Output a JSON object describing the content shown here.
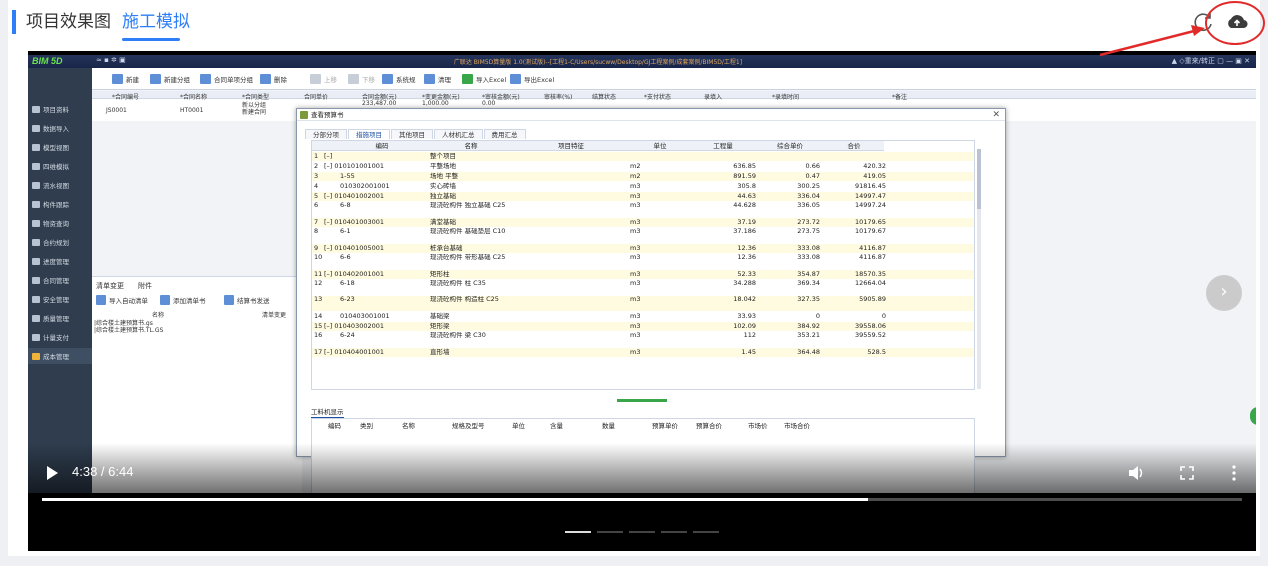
{
  "tabs": [
    {
      "label": "项目效果图",
      "active": false
    },
    {
      "label": "施工模拟",
      "active": true
    }
  ],
  "colors": {
    "accent": "#2d7ef7",
    "annotation": "#e12b2b",
    "highlight_green": "#3aa64a"
  },
  "toolbar_icons": [
    "refresh-icon",
    "cloud-upload-icon"
  ],
  "app": {
    "logo": "BIM 5D",
    "quick": "≈ ▪ ✲ ▣",
    "path": "广联达 BIM5D算量版 1.0(测试版)--[工程1-C/Users/sucww/Desktop/GJ工程案例/成套案例/BIM5D/工程1]",
    "window_controls": "▲ ◇重来/转正 ▢ — ▣ ✕",
    "ribbon": [
      {
        "label": "新建",
        "state": "on"
      },
      {
        "label": "新建分组",
        "state": "on"
      },
      {
        "label": "合同单项分组",
        "state": "on"
      },
      {
        "label": "删除",
        "state": "on"
      },
      {
        "label": "上移",
        "state": "dim"
      },
      {
        "label": "下移",
        "state": "dim"
      },
      {
        "label": "系统规",
        "state": "on"
      },
      {
        "label": "清理",
        "state": "on"
      },
      {
        "label": "导入Excel",
        "state": "green"
      },
      {
        "label": "导出Excel",
        "state": "on"
      }
    ],
    "sidebar": [
      "项目资料",
      "数据导入",
      "模型视图",
      "四维模拟",
      "流水视图",
      "构件跟踪",
      "物资查询",
      "合约规划",
      "进度管理",
      "合同管理",
      "安全管理",
      "质量管理",
      "计量支付",
      "成本管理"
    ],
    "sidebar_active_index": 13,
    "bg_headers": [
      "*合同编号",
      "*合同名称",
      "*合同类型",
      "合同单价",
      "合同金额(元)",
      "*变更金额(元)",
      "*审核金额(元)",
      "审核率(%)",
      "结算状态",
      "*支付状态",
      "录填入",
      "*录填时间",
      "*备注"
    ],
    "bg_rows": [
      [
        "",
        "",
        "新以分组",
        "",
        "233,487.00",
        "1,000.00",
        "0.00"
      ],
      [
        "JS0001",
        "HT0001",
        "新建合同",
        "",
        "",
        "",
        ""
      ]
    ],
    "lower_tabs": [
      "清单变更",
      "附件"
    ],
    "lower_buttons": [
      "导入自动清单",
      "添加清单书",
      "结算书发送"
    ],
    "lower_headers": [
      "名称",
      "清单变更"
    ],
    "lower_rows": [
      "|综合楼土建预算书.gs",
      "|综合楼土建预算书.TL.GS"
    ]
  },
  "dialog": {
    "title": "查看预算书",
    "close": "✕",
    "tabs": [
      {
        "label": "分部分项",
        "active": false
      },
      {
        "label": "措施项目",
        "active": true
      },
      {
        "label": "其他项目",
        "active": false
      },
      {
        "label": "人材机汇总",
        "active": false
      },
      {
        "label": "费用汇总",
        "active": false
      }
    ],
    "columns": [
      "编码",
      "名称",
      "项目特征",
      "单位",
      "工程量",
      "综合单价",
      "合价"
    ],
    "rows": [
      {
        "no": "1",
        "code": "[–]",
        "name": "整个项目",
        "unit": "",
        "qty": "",
        "price": "",
        "total": ""
      },
      {
        "no": "2",
        "code": "[–] 010101001001",
        "name": "平整场地",
        "unit": "m2",
        "qty": "636.85",
        "price": "0.66",
        "total": "420.32"
      },
      {
        "no": "3",
        "code": "1-55",
        "name": "场地 平整",
        "unit": "m2",
        "qty": "891.59",
        "price": "0.47",
        "total": "419.05"
      },
      {
        "no": "4",
        "code": "010302001001",
        "name": "实心砖墙",
        "unit": "m3",
        "qty": "305.8",
        "price": "300.25",
        "total": "91816.45"
      },
      {
        "no": "5",
        "code": "[–] 010401002001",
        "name": "独立基础",
        "unit": "m3",
        "qty": "44.63",
        "price": "336.04",
        "total": "14997.47"
      },
      {
        "no": "6",
        "code": "6-8",
        "name": "现浇砼构件 独立基础 C25",
        "unit": "m3",
        "qty": "44.628",
        "price": "336.05",
        "total": "14997.24"
      },
      {
        "no": "7",
        "code": "[–] 010401003001",
        "name": "满堂基础",
        "unit": "m3",
        "qty": "37.19",
        "price": "273.72",
        "total": "10179.65"
      },
      {
        "no": "8",
        "code": "6-1",
        "name": "现浇砼构件 基础垫层 C10",
        "unit": "m3",
        "qty": "37.186",
        "price": "273.75",
        "total": "10179.67"
      },
      {
        "no": "9",
        "code": "[–] 010401005001",
        "name": "桩承台基础",
        "unit": "m3",
        "qty": "12.36",
        "price": "333.08",
        "total": "4116.87"
      },
      {
        "no": "10",
        "code": "6-6",
        "name": "现浇砼构件 带形基础 C25",
        "unit": "m3",
        "qty": "12.36",
        "price": "333.08",
        "total": "4116.87"
      },
      {
        "no": "11",
        "code": "[–] 010402001001",
        "name": "矩形柱",
        "unit": "m3",
        "qty": "52.33",
        "price": "354.87",
        "total": "18570.35"
      },
      {
        "no": "12",
        "code": "6-18",
        "name": "现浇砼构件 柱 C35",
        "unit": "m3",
        "qty": "34.288",
        "price": "369.34",
        "total": "12664.04"
      },
      {
        "no": "13",
        "code": "6-23",
        "name": "现浇砼构件 构造柱 C25",
        "unit": "m3",
        "qty": "18.042",
        "price": "327.35",
        "total": "5905.89"
      },
      {
        "no": "14",
        "code": "010403001001",
        "name": "基础梁",
        "unit": "m3",
        "qty": "33.93",
        "price": "0",
        "total": "0"
      },
      {
        "no": "15",
        "code": "[–] 010403002001",
        "name": "矩形梁",
        "unit": "m3",
        "qty": "102.09",
        "price": "384.92",
        "total": "39558.06"
      },
      {
        "no": "16",
        "code": "6-24",
        "name": "现浇砼构件 梁 C30",
        "unit": "m3",
        "qty": "112",
        "price": "353.21",
        "total": "39559.52"
      },
      {
        "no": "17",
        "code": "[–] 010404001001",
        "name": "直形墙",
        "unit": "m3",
        "qty": "1.45",
        "price": "364.48",
        "total": "528.5"
      }
    ],
    "bottom_tab": "工料机显示",
    "bottom_columns": [
      "编码",
      "类别",
      "名称",
      "规格及型号",
      "单位",
      "含量",
      "数量",
      "预算单价",
      "预算合价",
      "市场价",
      "市场合价"
    ]
  },
  "video": {
    "time": "4:38 / 6:44",
    "progress_fraction": 0.688,
    "next_glyph": "›",
    "pager_pages": 5,
    "pager_active": 0
  }
}
